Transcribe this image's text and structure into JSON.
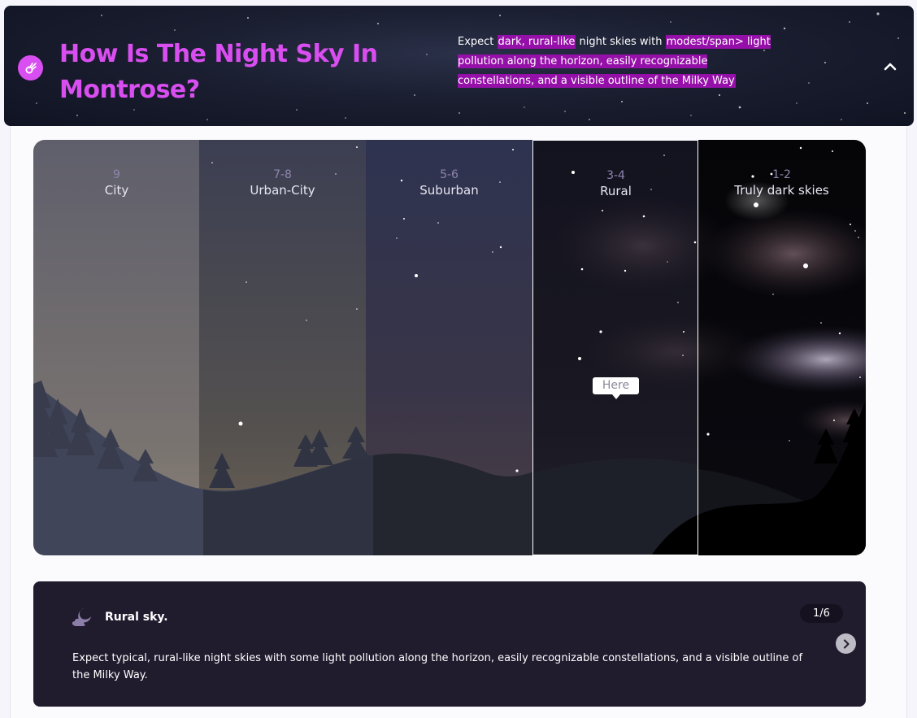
{
  "header": {
    "title": "How Is The Night Sky In Montrose?",
    "icon": "comet-icon",
    "description_prefix": "Expect ",
    "description_hl1": "dark, rural-like",
    "description_mid": " night skies with ",
    "description_hl2": "modest/span> light pollution along the horizon, easily recognizable constellations, and a visible outline of the Milky Way",
    "collapse_icon": "chevron-up-icon",
    "accent_color": "#d94ef0",
    "highlight_color": "#9510a8"
  },
  "sky": {
    "zones": [
      {
        "number": "9",
        "name": "City"
      },
      {
        "number": "7-8",
        "name": "Urban-City"
      },
      {
        "number": "5-6",
        "name": "Suburban"
      },
      {
        "number": "3-4",
        "name": "Rural"
      },
      {
        "number": "1-2",
        "name": "Truly dark skies"
      }
    ],
    "selected_zone": "Rural",
    "marker_label": "Here"
  },
  "card": {
    "icon": "moon-cloud-icon",
    "title": "Rural sky.",
    "page": "1/6",
    "next_icon": "chevron-right-icon",
    "text": "Expect typical, rural-like night skies with some light pollution along the horizon, easily recognizable constellations, and a visible outline of the Milky Way.",
    "background_color": "#211b2e"
  }
}
